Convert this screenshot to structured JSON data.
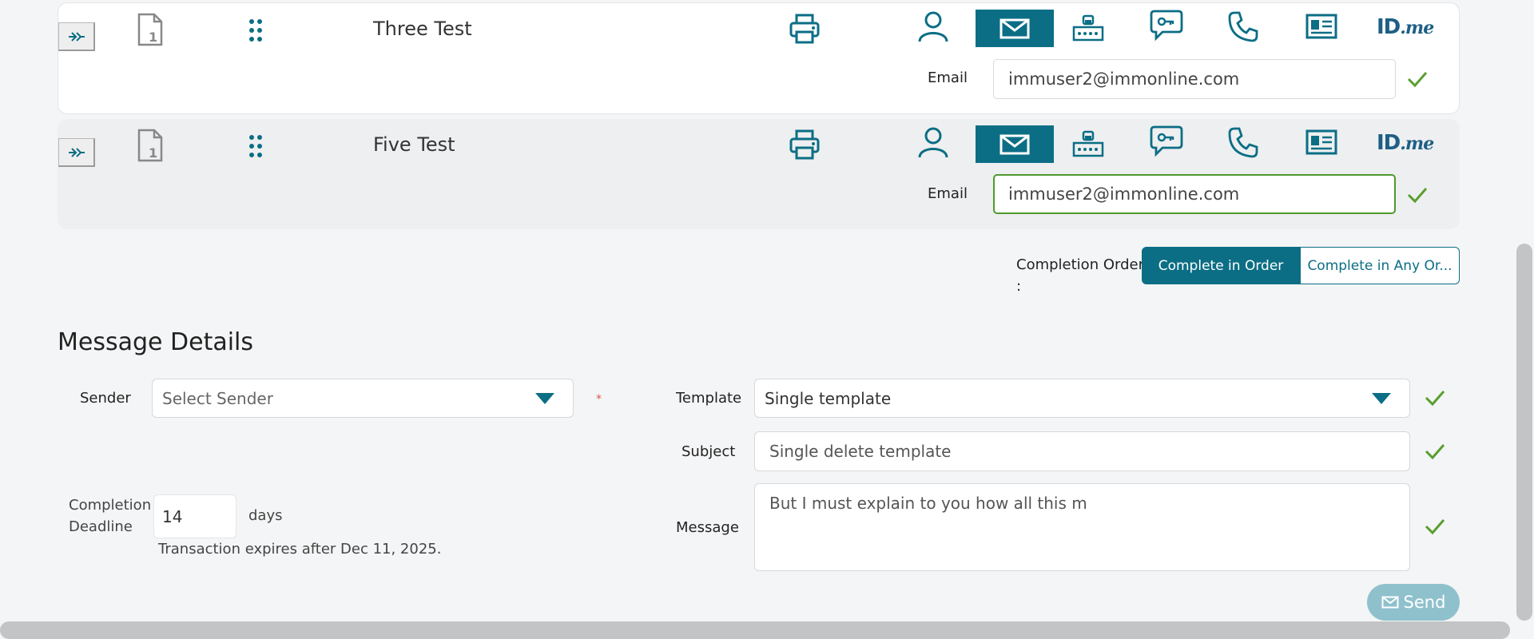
{
  "signers": [
    {
      "name": "Three Test",
      "email_label": "Email",
      "email_value": "immuser2@immonline.com",
      "selected_method": "email"
    },
    {
      "name": "Five Test",
      "email_label": "Email",
      "email_value": "immuser2@immonline.com",
      "selected_method": "email"
    }
  ],
  "idme_label": "ID.me",
  "completion_order": {
    "label_line1": "Completion Order",
    "label_line2": ":",
    "options": [
      "Complete in Order",
      "Complete in Any Or..."
    ],
    "selected": "Complete in Order"
  },
  "message_details": {
    "title": "Message Details",
    "sender_label": "Sender",
    "sender_placeholder": "Select Sender",
    "required_mark": "*",
    "template_label": "Template",
    "template_value": "Single template",
    "subject_label": "Subject",
    "subject_value": "Single delete template",
    "message_label": "Message",
    "message_value": "But I must explain to you how all this m",
    "deadline_label_line1": "Completion",
    "deadline_label_line2": "Deadline",
    "deadline_value": "14",
    "deadline_unit": "days",
    "expiry_note": "Transaction expires after Dec 11, 2025."
  },
  "send_label": "Send",
  "colors": {
    "teal": "#0b6e85",
    "check_green": "#5a9e2f",
    "send_bg": "#8fc1cc"
  }
}
